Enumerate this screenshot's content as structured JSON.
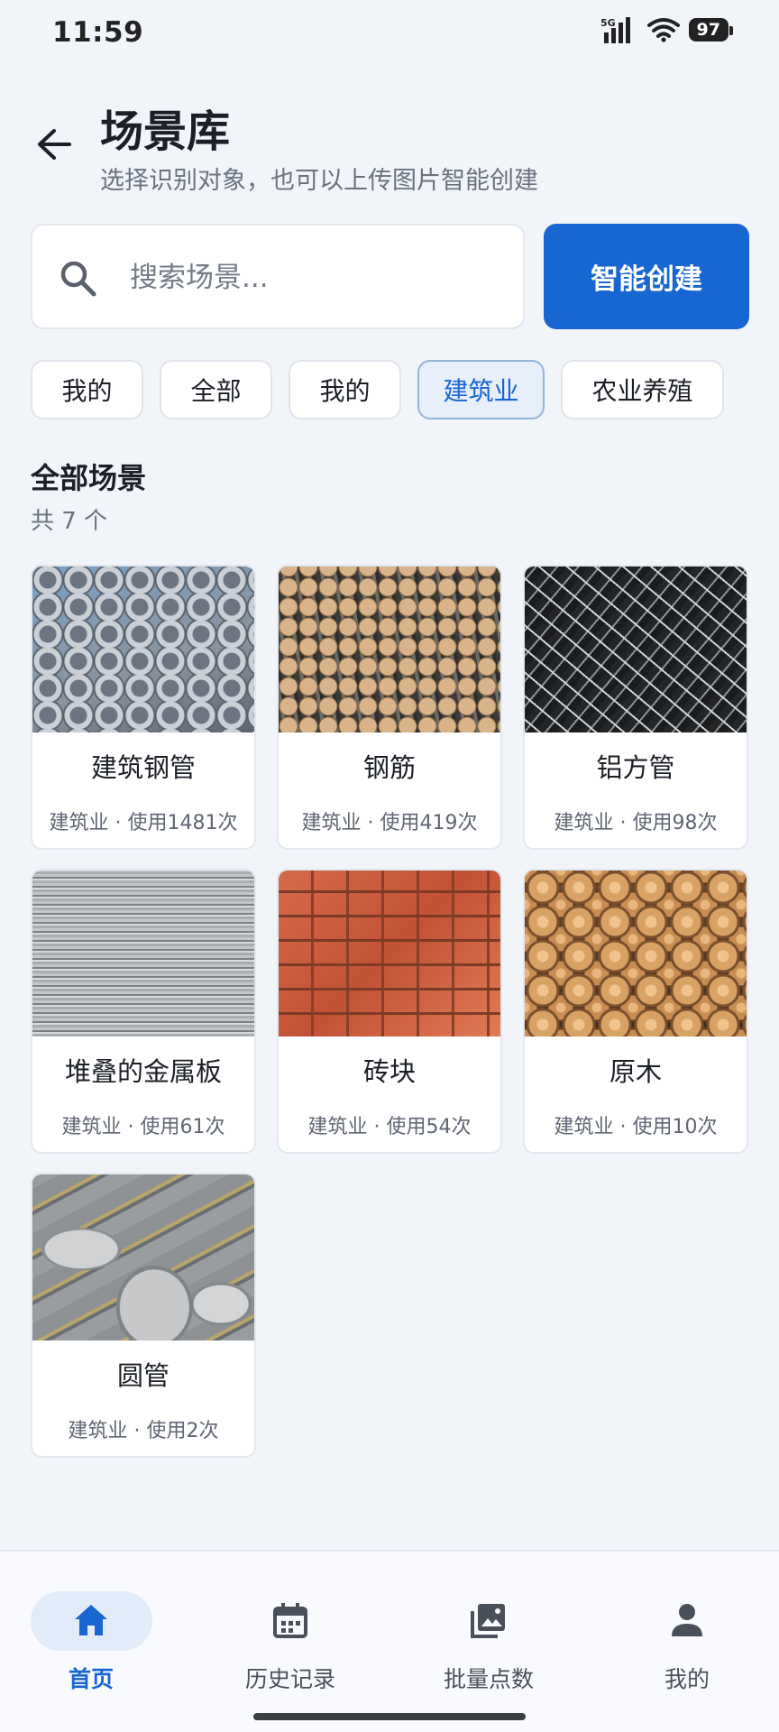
{
  "status_bar": {
    "time": "11:59",
    "network": "5G",
    "battery": "97"
  },
  "header": {
    "title": "场景库",
    "subtitle": "选择识别对象，也可以上传图片智能创建"
  },
  "search": {
    "placeholder": "搜索场景..."
  },
  "create_button": {
    "label": "智能创建"
  },
  "filters": [
    {
      "label": "我的",
      "active": false
    },
    {
      "label": "全部",
      "active": false
    },
    {
      "label": "我的",
      "active": false
    },
    {
      "label": "建筑业",
      "active": true
    },
    {
      "label": "农业养殖",
      "active": false
    }
  ],
  "section": {
    "title": "全部场景",
    "count_text": "共 7 个"
  },
  "cards": [
    {
      "name": "建筑钢管",
      "meta": "建筑业 · 使用1481次",
      "image": "galvanized-steel-pipes"
    },
    {
      "name": "钢筋",
      "meta": "建筑业 · 使用419次",
      "image": "rebar-bundle"
    },
    {
      "name": "铝方管",
      "meta": "建筑业 · 使用98次",
      "image": "aluminum-square-tubes"
    },
    {
      "name": "堆叠的金属板",
      "meta": "建筑业 · 使用61次",
      "image": "stacked-metal-sheets"
    },
    {
      "name": "砖块",
      "meta": "建筑业 · 使用54次",
      "image": "red-bricks"
    },
    {
      "name": "原木",
      "meta": "建筑业 · 使用10次",
      "image": "log-pile"
    },
    {
      "name": "圆管",
      "meta": "建筑业 · 使用2次",
      "image": "round-steel-bars"
    }
  ],
  "bottom_nav": [
    {
      "label": "首页",
      "icon": "home-icon",
      "active": true
    },
    {
      "label": "历史记录",
      "icon": "calendar-icon",
      "active": false
    },
    {
      "label": "批量点数",
      "icon": "image-library-icon",
      "active": false
    },
    {
      "label": "我的",
      "icon": "person-icon",
      "active": false
    }
  ],
  "colors": {
    "accent": "#1866d2",
    "background": "#f1f5fa",
    "chip_active_bg": "#e6effa"
  }
}
